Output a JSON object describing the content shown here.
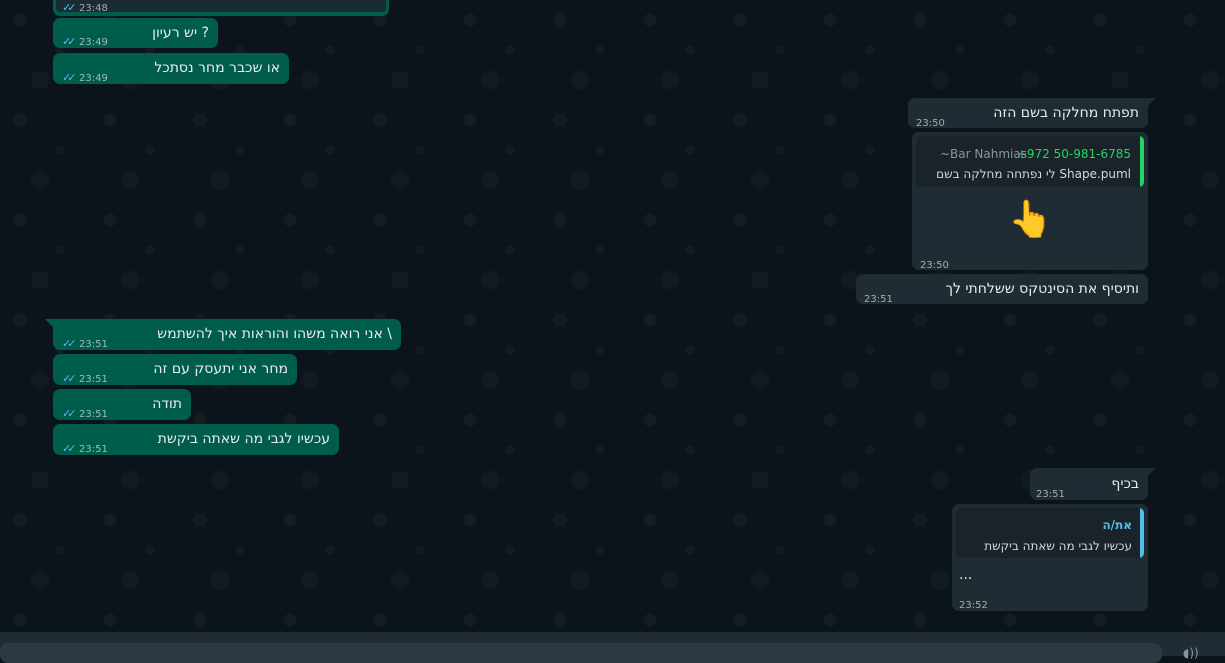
{
  "colors": {
    "outgoing_bubble": "#005c4b",
    "incoming_bubble": "#202c33",
    "background": "#0b141a",
    "read_ticks": "#53bdeb",
    "phone_green": "#25d366",
    "quote_name_blue": "#53bdeb"
  },
  "icons": {
    "read_receipt": "double-check-icon",
    "footer_left": "voice-icon"
  },
  "messages": {
    "m0": {
      "time": "23:48"
    },
    "m1": {
      "text": "יש רעיון ?",
      "time": "23:49"
    },
    "m2": {
      "text": "או שכבר מחר נסתכל",
      "time": "23:49"
    },
    "m3": {
      "text": "תפתח מחלקה בשם הזה",
      "time": "23:50"
    },
    "m4": {
      "quote_name": "~Bar Nahmias",
      "quote_phone": "+972 50-981-6785",
      "quote_text": "לי נפתחה מחלקה בשם Shape.puml",
      "emoji": "👆",
      "time": "23:50"
    },
    "m5": {
      "text": "ותיסיף את הסינטקס ששלחתי לך",
      "time": "23:51"
    },
    "m6": {
      "text": "אני רואה משהו והוראות איך להשתמש \\",
      "time": "23:51"
    },
    "m7": {
      "text": "מחר אני יתעסק עם זה",
      "time": "23:51"
    },
    "m8": {
      "text": "תודה",
      "time": "23:51"
    },
    "m9": {
      "text": "עכשיו לגבי מה שאתה ביקשת",
      "time": "23:51"
    },
    "m10": {
      "text": "בכיף",
      "time": "23:51"
    },
    "m11": {
      "quote_name": "את/ה",
      "quote_text": "עכשיו לגבי מה שאתה ביקשת",
      "text": "...",
      "time": "23:52"
    }
  }
}
